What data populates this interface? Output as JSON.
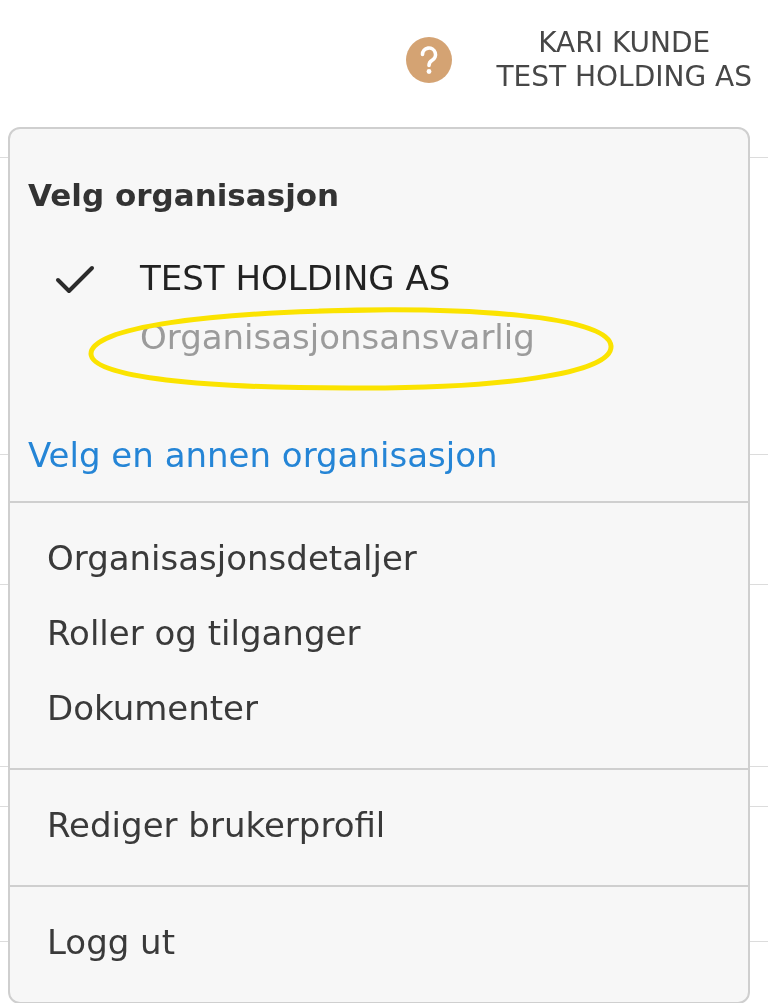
{
  "header": {
    "user_menu": {
      "name": "KARI KUNDE",
      "organization": "TEST HOLDING AS",
      "expanded": true
    }
  },
  "dropdown": {
    "heading": "Velg organisasjon",
    "organizations": [
      {
        "name": "TEST HOLDING AS",
        "role": "Organisasjonsansvarlig",
        "selected": true,
        "circled": true
      }
    ],
    "switch_link": "Velg en annen organisasjon",
    "sections": [
      {
        "items": [
          "Organisasjonsdetaljer",
          "Roller og tilganger",
          "Dokumenter"
        ]
      },
      {
        "items": [
          "Rediger brukerprofil"
        ]
      },
      {
        "items": [
          "Logg ut"
        ]
      }
    ]
  }
}
